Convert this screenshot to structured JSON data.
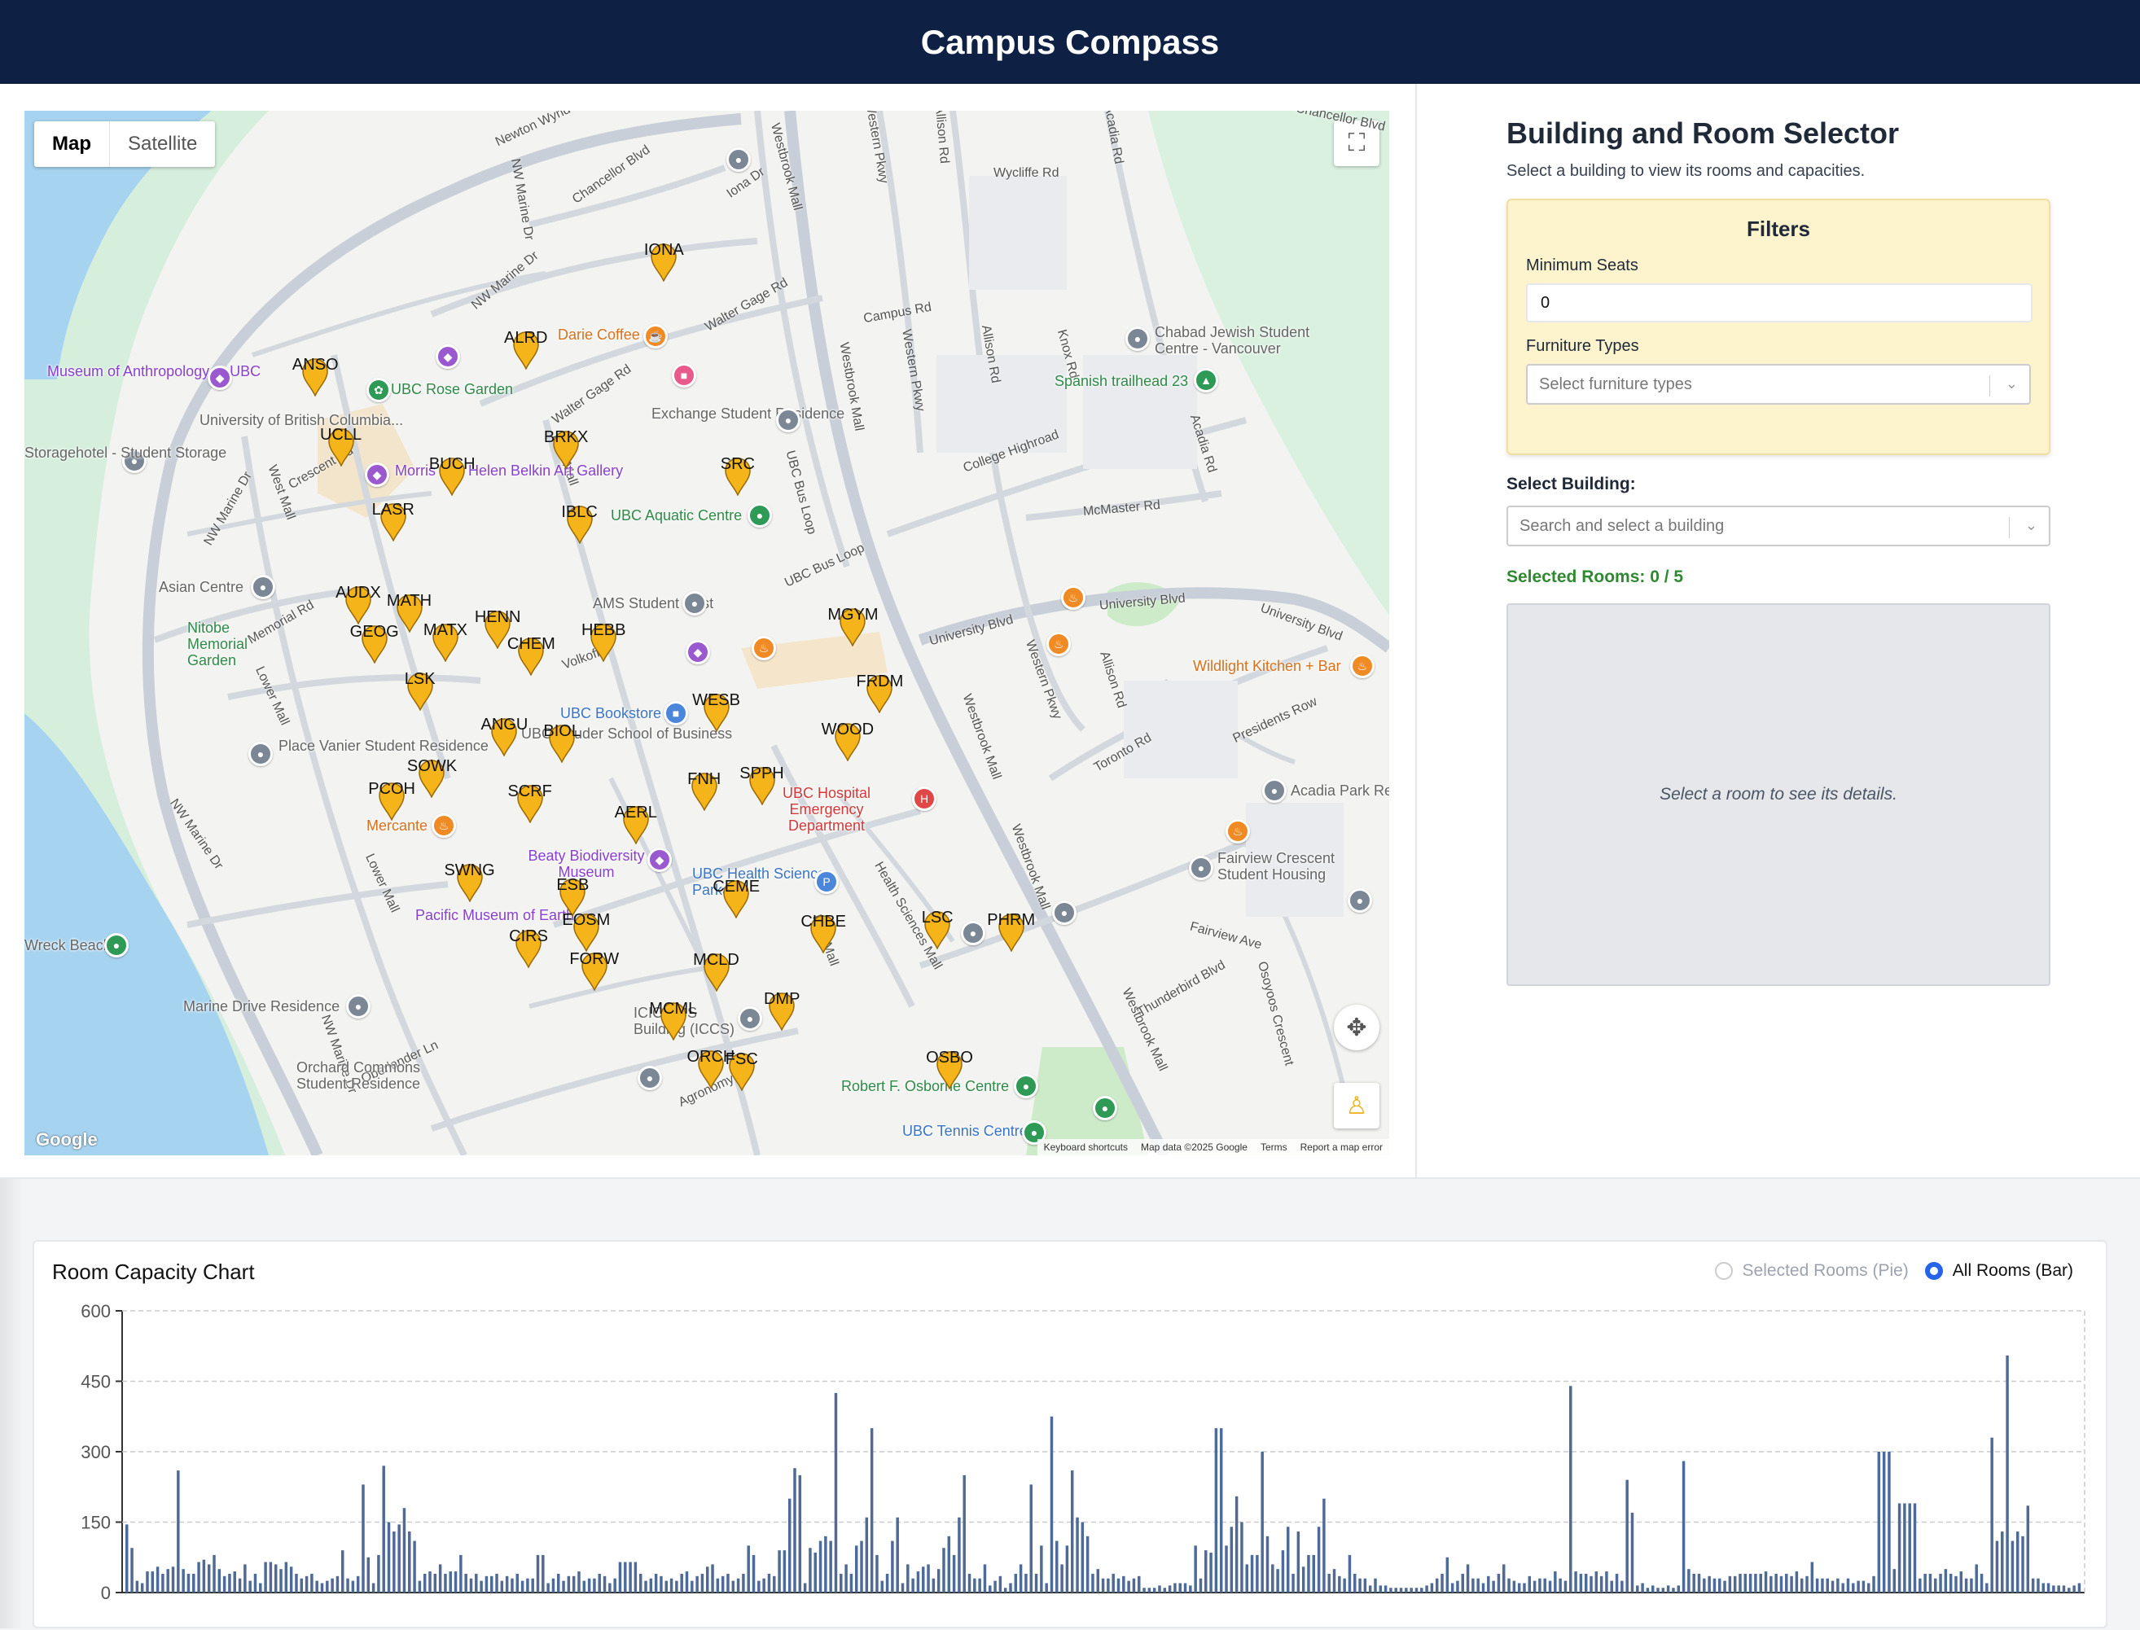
{
  "app": {
    "title": "Campus Compass"
  },
  "map": {
    "map_type_buttons": [
      "Map",
      "Satellite"
    ],
    "google": "Google",
    "attribution": [
      "Keyboard shortcuts",
      "Map data ©2025 Google",
      "Terms",
      "Report a map error"
    ],
    "roads": [
      "Newton Wynd",
      "Chancellor Blvd",
      "NW Marine Dr",
      "Iona Dr",
      "Westbrook Mall",
      "Western Pkwy",
      "Allison Rd",
      "Acadia Rd",
      "Wycliffe Rd",
      "Walter Gage Rd",
      "Campus Rd",
      "Knox Rd",
      "College Highroad",
      "McMaster Rd",
      "UBC Bus Loop",
      "University Blvd",
      "Memorial Rd",
      "Lower Mall",
      "West Mall",
      "East Mall",
      "Crescent Rd",
      "Toronto Rd",
      "Presidents Row",
      "Health Sciences Mall",
      "Thunderbird Blvd",
      "Fairview Ave",
      "Osoyoos Crescent",
      "Agronomy Rd",
      "Oberlander Ln",
      "Volkoff"
    ],
    "places": [
      "Museum of Anthropology at UBC",
      "UBC Rose Garden",
      "University of British Columbia...",
      "Storagehotel - Student Storage",
      "Morris and Helen Belkin Art Gallery",
      "Darie Coffee",
      "Exchange Student Residence",
      "UBC Aquatic Centre",
      "Chabad Jewish Student Centre - Vancouver",
      "Spanish trailhead 23",
      "Asian Centre",
      "Nitobe Memorial Garden",
      "AMS Student Nest",
      "Place Vanier Student Residence",
      "UBC Bookstore",
      "UBC Sauder School of Business",
      "Wildlight Kitchen + Bar",
      "Mercante",
      "UBC Hospital Emergency Department",
      "Beaty Biodiversity Museum",
      "UBC Health Sciences Parkade",
      "Pacific Museum of Earth",
      "Acadia Park Re",
      "Fairview Crescent Student Housing",
      "Marine Drive Residence",
      "Orchard Commons Student Residence",
      "Robert F. Osborne Centre",
      "UBC Tennis Centre",
      "Wreck Beach",
      "ICICS/CS Building (ICCS)"
    ],
    "markers": [
      "IONA",
      "ALRD",
      "ANSO",
      "UCLL",
      "BRKX",
      "BUCH",
      "SRC",
      "LASR",
      "IBLC",
      "AUDX",
      "MATH",
      "HENN",
      "GEOG",
      "MATX",
      "CHEM",
      "HEBB",
      "MGYM",
      "LSK",
      "FRDM",
      "WESB",
      "ANGU",
      "BIOL",
      "WOOD",
      "SOWK",
      "FNH",
      "SPPH",
      "PCOH",
      "SCRF",
      "AERL",
      "SWNG",
      "ESB",
      "CEME",
      "LSC",
      "PHRM",
      "EOSM",
      "CHBE",
      "CIRS",
      "FORW",
      "MCLD",
      "DMP",
      "MCML",
      "ORCH",
      "FSC",
      "OSBO"
    ]
  },
  "selector": {
    "title": "Building and Room Selector",
    "subtitle": "Select a building to view its rooms and capacities.",
    "filters_title": "Filters",
    "min_seats_label": "Minimum Seats",
    "min_seats_value": "0",
    "furniture_label": "Furniture Types",
    "furniture_placeholder": "Select furniture types",
    "building_label": "Select Building:",
    "building_placeholder": "Search and select a building",
    "selected_rooms": "Selected Rooms: 0 / 5",
    "details_placeholder": "Select a room to see its details."
  },
  "chart_data": {
    "type": "bar",
    "title": "Room Capacity Chart",
    "toggle": {
      "pie": "Selected Rooms (Pie)",
      "bar": "All Rooms (Bar)",
      "selected": "bar"
    },
    "ylim": [
      0,
      600
    ],
    "yticks": [
      "0",
      "150",
      "300",
      "450",
      "600"
    ],
    "grid": true,
    "color": "#4e6a96",
    "values": [
      145,
      95,
      25,
      20,
      45,
      45,
      55,
      40,
      50,
      55,
      260,
      50,
      40,
      40,
      65,
      70,
      60,
      80,
      50,
      35,
      40,
      45,
      30,
      60,
      25,
      40,
      20,
      65,
      65,
      60,
      50,
      65,
      55,
      40,
      30,
      35,
      40,
      25,
      20,
      25,
      30,
      35,
      90,
      30,
      25,
      35,
      230,
      75,
      20,
      80,
      270,
      150,
      130,
      145,
      180,
      130,
      110,
      25,
      40,
      45,
      40,
      60,
      40,
      45,
      45,
      80,
      40,
      30,
      40,
      25,
      35,
      35,
      40,
      25,
      35,
      30,
      40,
      25,
      30,
      30,
      80,
      80,
      20,
      30,
      40,
      25,
      35,
      35,
      45,
      25,
      30,
      30,
      40,
      35,
      20,
      30,
      65,
      65,
      65,
      65,
      40,
      25,
      30,
      40,
      35,
      25,
      30,
      25,
      40,
      45,
      25,
      35,
      40,
      55,
      60,
      30,
      35,
      40,
      25,
      30,
      40,
      100,
      80,
      25,
      30,
      40,
      35,
      90,
      90,
      200,
      265,
      250,
      20,
      95,
      85,
      110,
      120,
      110,
      425,
      40,
      60,
      40,
      100,
      110,
      160,
      350,
      80,
      25,
      40,
      110,
      160,
      20,
      60,
      30,
      45,
      55,
      60,
      30,
      50,
      95,
      120,
      80,
      160,
      250,
      40,
      30,
      30,
      60,
      15,
      25,
      35,
      10,
      20,
      40,
      60,
      40,
      230,
      40,
      100,
      20,
      375,
      110,
      60,
      100,
      260,
      160,
      150,
      120,
      40,
      50,
      30,
      30,
      40,
      30,
      35,
      25,
      30,
      35,
      10,
      10,
      10,
      15,
      10,
      15,
      20,
      20,
      20,
      15,
      100,
      30,
      90,
      85,
      350,
      350,
      100,
      140,
      205,
      150,
      60,
      80,
      80,
      300,
      120,
      60,
      50,
      90,
      140,
      40,
      130,
      55,
      80,
      80,
      140,
      200,
      40,
      50,
      35,
      30,
      80,
      40,
      30,
      30,
      15,
      30,
      15,
      15,
      10,
      10,
      10,
      10,
      10,
      10,
      10,
      15,
      20,
      30,
      40,
      75,
      20,
      25,
      40,
      60,
      30,
      30,
      20,
      35,
      25,
      40,
      60,
      30,
      25,
      20,
      20,
      35,
      25,
      30,
      30,
      25,
      45,
      30,
      25,
      440,
      45,
      40,
      40,
      35,
      45,
      35,
      45,
      25,
      40,
      25,
      240,
      170,
      15,
      20,
      10,
      15,
      10,
      10,
      15,
      10,
      15,
      280,
      50,
      40,
      40,
      30,
      35,
      30,
      30,
      25,
      35,
      35,
      40,
      40,
      40,
      40,
      40,
      45,
      35,
      40,
      35,
      40,
      35,
      45,
      30,
      35,
      65,
      30,
      30,
      30,
      25,
      30,
      20,
      30,
      20,
      25,
      25,
      20,
      35,
      300,
      300,
      300,
      50,
      190,
      190,
      190,
      190,
      30,
      40,
      40,
      30,
      40,
      50,
      40,
      35,
      45,
      30,
      30,
      60,
      40,
      20,
      330,
      110,
      130,
      505,
      110,
      130,
      120,
      185,
      30,
      30,
      20,
      20,
      15,
      15,
      15,
      10,
      15,
      20
    ]
  }
}
